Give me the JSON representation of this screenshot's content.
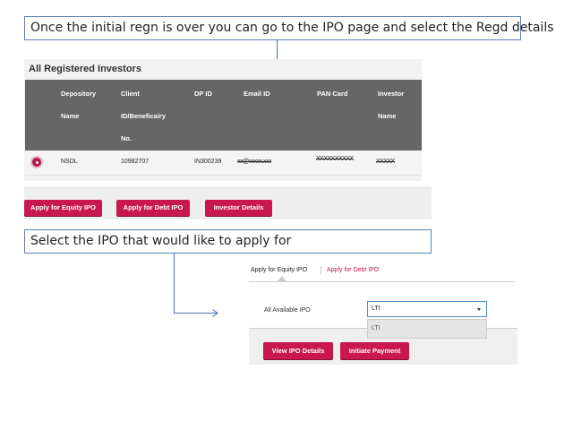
{
  "callouts": {
    "top": "Once the initial regn is over you can go to the IPO page and select the Regd details",
    "middle": "Select the IPO that would like to apply for"
  },
  "investors": {
    "title": "All Registered Investors",
    "headers": {
      "depository_1": "Depository",
      "depository_2": "Name",
      "client_1": "Client",
      "client_2": "ID/Beneficairy",
      "client_3": "No.",
      "dpid": "DP ID",
      "email": "Email ID",
      "pan": "PAN Card",
      "investor_1": "Investor",
      "investor_2": "Name"
    },
    "row": {
      "depository": "NSDL",
      "client_id": "10982707",
      "dp_id": "IN300239",
      "email": "xx@xxxxx.xxx",
      "pan": "XXXXXXXXXX",
      "investor": "XXXXX"
    }
  },
  "actions": {
    "equity": "Apply for Equity IPO",
    "debt": "Apply for Debt IPO",
    "details": "Investor Details"
  },
  "ipo_panel": {
    "tab_equity": "Apply for Equity IPO",
    "tab_debt": "Apply for Debt IPO",
    "label": "All Available IPO",
    "selected": "LTI",
    "option": "LTI",
    "view_button": "View IPO Details",
    "pay_button": "Initiate Payment"
  },
  "colors": {
    "accent": "#c8184f",
    "header_bg": "#666666",
    "callout_border": "#5b7fb8"
  }
}
